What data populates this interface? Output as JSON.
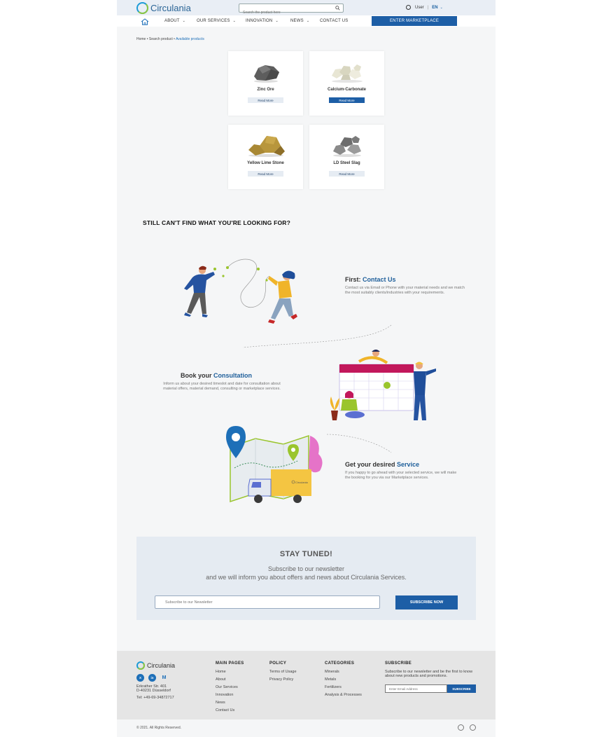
{
  "header": {
    "logo_text": "Circulania",
    "search_placeholder": "Search the product here",
    "user_label": "User",
    "separator": "|",
    "language": "EN",
    "colors": {
      "brand_blue": "#1d5ea6",
      "logo_blue": "#1e9bd7",
      "logo_green": "#8cc63f"
    }
  },
  "nav": {
    "items": [
      {
        "label": "ABOUT",
        "caret": "⌄"
      },
      {
        "label": "OUR SERVICES",
        "caret": "⌄"
      },
      {
        "label": "INNOVATION",
        "caret": "⌄"
      },
      {
        "label": "NEWS",
        "caret": "⌄"
      },
      {
        "label": "CONTACT US",
        "caret": ""
      }
    ],
    "marketplace_label": "ENTER MARKETPLACE"
  },
  "breadcrumb": {
    "home": "Home",
    "sep": " • ",
    "search": "Search product",
    "current": "Available products"
  },
  "products": [
    {
      "name": "Zinc Ore",
      "button": "Read More",
      "active": false
    },
    {
      "name": "Calcium-Carbonate",
      "button": "Read More",
      "active": true
    },
    {
      "name": "Yellow Lime Stone",
      "button": "Read More",
      "active": false
    },
    {
      "name": "LD Steel Slag",
      "button": "Read More",
      "active": false
    }
  ],
  "cant_find": "STILL CAN'T FIND WHAT YOU'RE LOOKING FOR?",
  "steps": [
    {
      "title": "First:",
      "highlight": "Contact Us",
      "text": "Contact us via Email or Phone with your material needs and we match the most suitably clients/industries with your requirements."
    },
    {
      "title": "Book your",
      "highlight": "Consultation",
      "text": "Inform us about your desired timeslot and date for consultation about material offers, material demand, consulting or marketplace services."
    },
    {
      "title": "Get your desired",
      "highlight": "Service",
      "text": "If you happy to go ahead with your selected service, we will make the booking for you via our Marketplace services."
    }
  ],
  "truck_label": "Circulania",
  "newsletter": {
    "title": "STAY TUNED!",
    "line1": "Subscribe to our newsletter",
    "line2": "and we will inform you about offers and news about Circulania Services.",
    "placeholder": "Subscribe to our Newsletter",
    "button": "SUBSCRIBE NOW"
  },
  "footer": {
    "logo_text": "Circulania",
    "social": [
      "X",
      "in",
      "M"
    ],
    "address_line1": "Erkrather Str. 401",
    "address_line2": "D-40231 Düsseldorf",
    "tel": "Tel: +49-69-34872717",
    "main_pages": {
      "title": "MAIN PAGES",
      "links": [
        "Home",
        "About",
        "Our Services",
        "Innovation",
        "News",
        "Contact Us"
      ]
    },
    "policy": {
      "title": "POLICY",
      "links": [
        "Terms of Usage",
        "Privacy Policy"
      ]
    },
    "categories": {
      "title": "CATEGORIES",
      "links": [
        "Minerals",
        "Metals",
        "Fertilizers",
        "Analysis & Processes"
      ]
    },
    "subscribe": {
      "title": "SUBSCRIBE",
      "text": "Subscribe to our newsletter and be the first to know about new products and promotions.",
      "placeholder": "Enter Email Address",
      "button": "SUBSCRIBE"
    },
    "copyright": "© 2021. All Rights Reserved."
  }
}
